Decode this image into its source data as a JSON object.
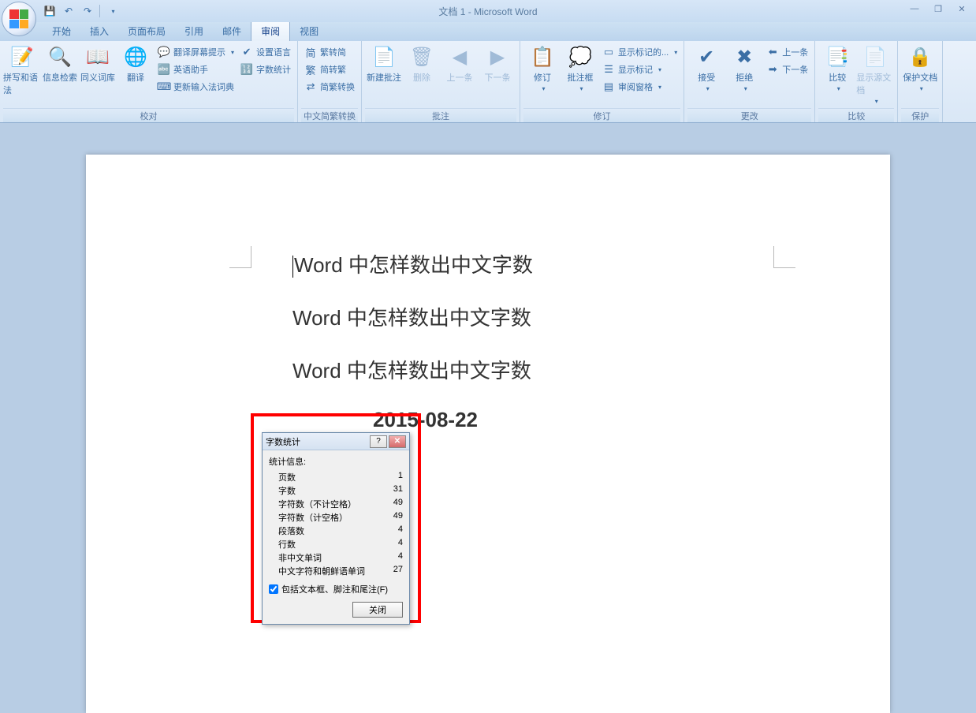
{
  "title": "文档 1 - Microsoft Word",
  "qat": {
    "save_icon": "💾",
    "undo": "↶",
    "redo": "↷"
  },
  "win": {
    "min": "—",
    "max": "❐",
    "close": "✕"
  },
  "tabs": [
    "开始",
    "插入",
    "页面布局",
    "引用",
    "邮件",
    "审阅",
    "视图"
  ],
  "active_tab": 5,
  "groups": {
    "proof": {
      "label": "校对",
      "spellgrammar": "拼写和语法",
      "thesaurus_big": "信息检索",
      "thesaurus2": "同义词库",
      "translate": "翻译",
      "translate_tip": "翻译屏幕提示",
      "english_helper": "英语助手",
      "update_ime": "更新输入法词典",
      "set_lang": "设置语言",
      "word_count": "字数统计"
    },
    "chinese": {
      "label": "中文简繁转换",
      "sc2tc": "繁转简",
      "tc2sc": "简转繁",
      "convert": "简繁转换"
    },
    "comments": {
      "label": "批注",
      "new": "新建批注",
      "delete": "删除",
      "prev": "上一条",
      "next": "下一条"
    },
    "tracking": {
      "label": "修订",
      "track": "修订",
      "balloons": "批注框",
      "show_markup_display": "显示标记的...",
      "show_markup": "显示标记",
      "reviewing_pane": "审阅窗格"
    },
    "changes": {
      "label": "更改",
      "accept": "接受",
      "reject": "拒绝",
      "prev": "上一条",
      "next": "下一条"
    },
    "compare": {
      "label": "比较",
      "compare": "比较",
      "source": "显示源文档"
    },
    "protect": {
      "label": "保护",
      "protect": "保护文档"
    }
  },
  "doc": {
    "line1": "Word 中怎样数出中文字数",
    "line2": "Word 中怎样数出中文字数",
    "line3": "Word 中怎样数出中文字数",
    "line4": "2015-08-22"
  },
  "dialog": {
    "title": "字数统计",
    "heading": "统计信息:",
    "stats": [
      {
        "label": "页数",
        "value": "1"
      },
      {
        "label": "字数",
        "value": "31"
      },
      {
        "label": "字符数（不计空格）",
        "value": "49"
      },
      {
        "label": "字符数（计空格）",
        "value": "49"
      },
      {
        "label": "段落数",
        "value": "4"
      },
      {
        "label": "行数",
        "value": "4"
      },
      {
        "label": "非中文单词",
        "value": "4"
      },
      {
        "label": "中文字符和朝鲜语单词",
        "value": "27"
      }
    ],
    "checkbox": "包括文本框、脚注和尾注(F)",
    "close": "关闭"
  }
}
